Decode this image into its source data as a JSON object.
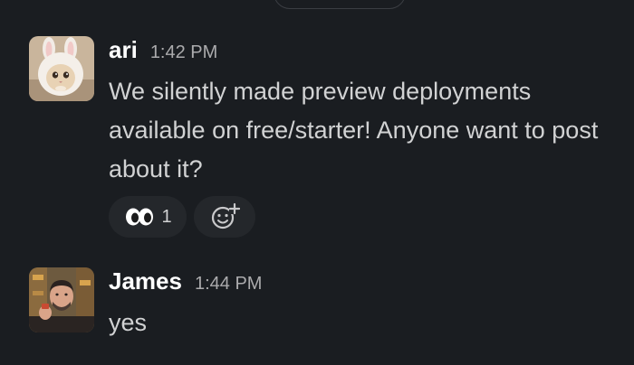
{
  "messages": [
    {
      "author": "ari",
      "time": "1:42 PM",
      "text": "We silently made preview deployments available on free/starter! Anyone want to post about it?",
      "avatar_icon": "bunny-hat-cat-avatar",
      "reactions": [
        {
          "emoji": "eyes",
          "glyph": "👀",
          "count": "1"
        }
      ],
      "add_reaction_icon": "add-reaction-icon"
    },
    {
      "author": "James",
      "time": "1:44 PM",
      "text": "yes",
      "avatar_icon": "person-photo-avatar"
    }
  ],
  "colors": {
    "background": "#1a1d21",
    "author": "#ffffff",
    "text": "#d1d2d3",
    "timestamp": "#ababad",
    "reaction_bg": "#24272b"
  }
}
